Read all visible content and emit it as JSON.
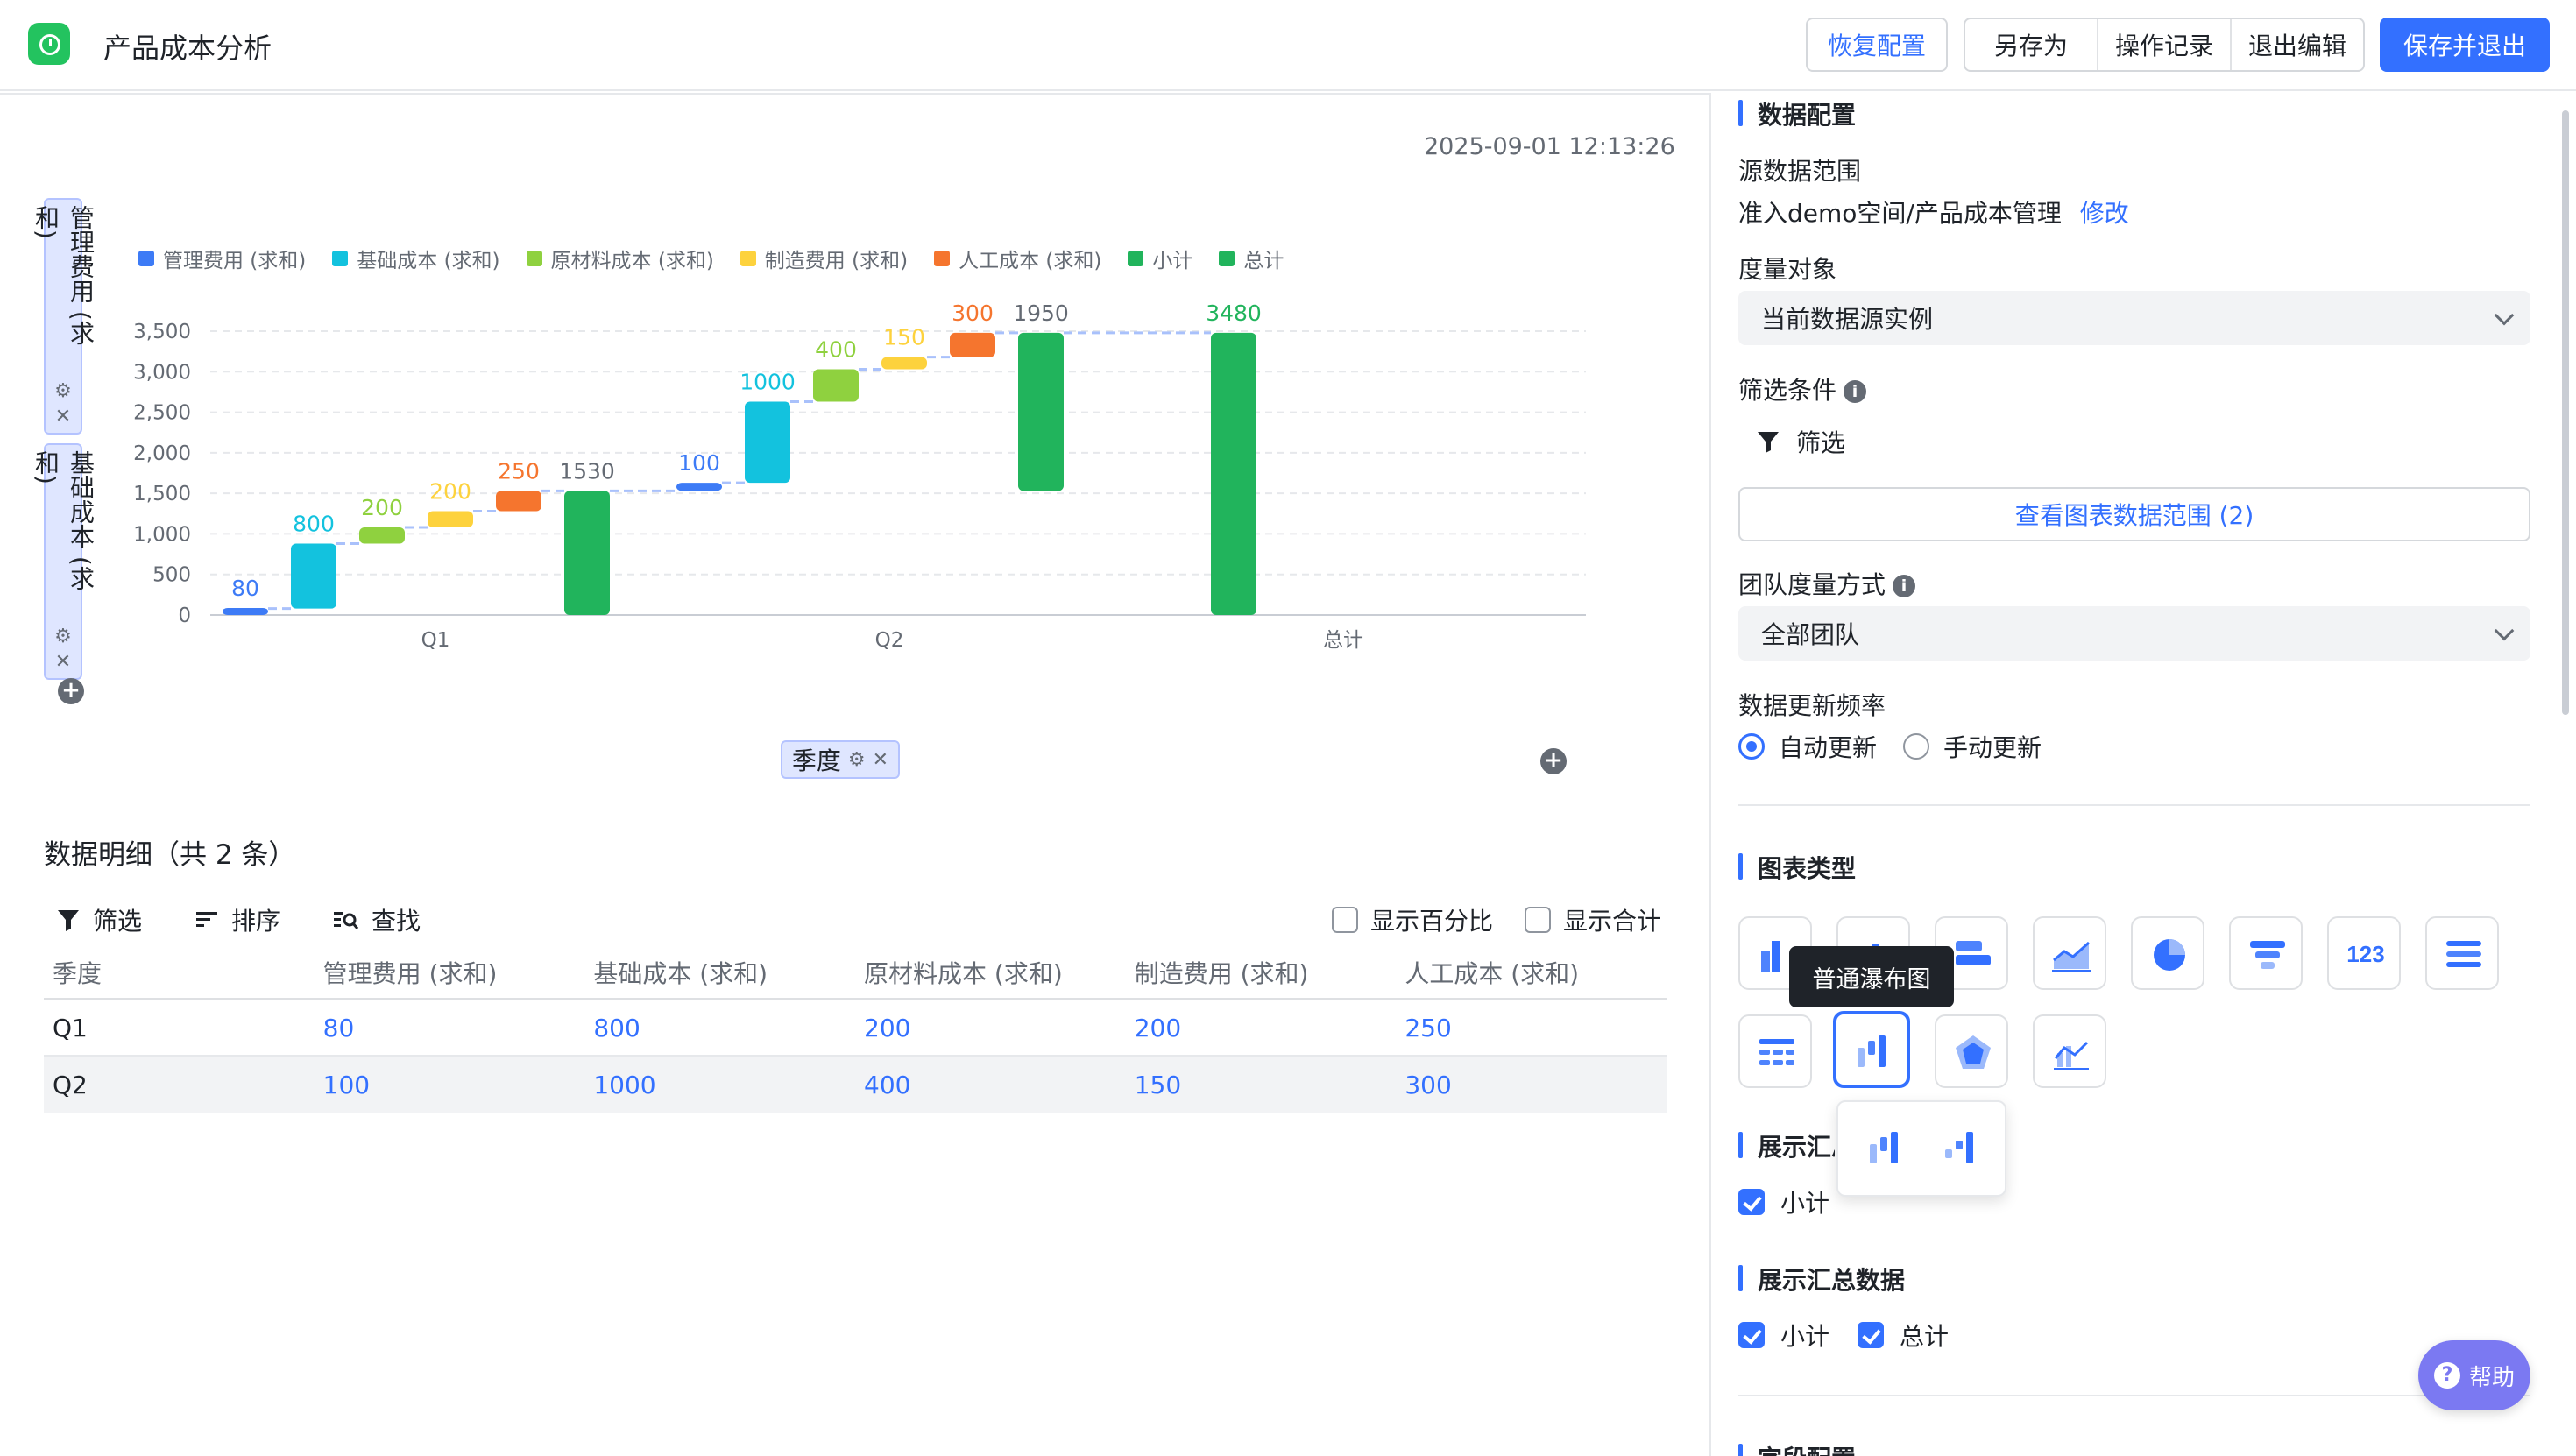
{
  "header": {
    "title": "产品成本分析",
    "restore_label": "恢复配置",
    "save_as_label": "另存为",
    "history_label": "操作记录",
    "exit_edit_label": "退出编辑",
    "save_exit_label": "保存并退出"
  },
  "chart_area": {
    "timestamp": "2025-09-01 12:13:26",
    "y_fields": [
      "管理费用 (求和)",
      "基础成本 (求和)"
    ],
    "x_field": "季度"
  },
  "chart_data": {
    "type": "waterfall",
    "legend": [
      {
        "name": "管理费用 (求和)",
        "color": "#3d7bf6"
      },
      {
        "name": "基础成本 (求和)",
        "color": "#13c2de"
      },
      {
        "name": "原材料成本 (求和)",
        "color": "#8fd13f"
      },
      {
        "name": "制造费用 (求和)",
        "color": "#fdd23d"
      },
      {
        "name": "人工成本 (求和)",
        "color": "#f5752e"
      },
      {
        "name": "小计",
        "color": "#21b45c"
      },
      {
        "name": "总计",
        "color": "#21b45c"
      }
    ],
    "categories": [
      "Q1",
      "Q2",
      "总计"
    ],
    "y_ticks": [
      "3,500",
      "3,000",
      "2,500",
      "2,000",
      "1,500",
      "1,000",
      "500",
      "0"
    ],
    "ylim": [
      0,
      3500
    ],
    "bars": [
      {
        "group": "Q1",
        "series": "管理费用 (求和)",
        "start": 0,
        "end": 80,
        "label": "80"
      },
      {
        "group": "Q1",
        "series": "基础成本 (求和)",
        "start": 80,
        "end": 880,
        "label": "800"
      },
      {
        "group": "Q1",
        "series": "原材料成本 (求和)",
        "start": 880,
        "end": 1080,
        "label": "200"
      },
      {
        "group": "Q1",
        "series": "制造费用 (求和)",
        "start": 1080,
        "end": 1280,
        "label": "200"
      },
      {
        "group": "Q1",
        "series": "人工成本 (求和)",
        "start": 1280,
        "end": 1530,
        "label": "250"
      },
      {
        "group": "Q1",
        "series": "小计",
        "start": 0,
        "end": 1530,
        "label": "1530"
      },
      {
        "group": "Q2",
        "series": "管理费用 (求和)",
        "start": 1530,
        "end": 1630,
        "label": "100"
      },
      {
        "group": "Q2",
        "series": "基础成本 (求和)",
        "start": 1630,
        "end": 2630,
        "label": "1000"
      },
      {
        "group": "Q2",
        "series": "原材料成本 (求和)",
        "start": 2630,
        "end": 3030,
        "label": "400"
      },
      {
        "group": "Q2",
        "series": "制造费用 (求和)",
        "start": 3030,
        "end": 3180,
        "label": "150"
      },
      {
        "group": "Q2",
        "series": "人工成本 (求和)",
        "start": 3180,
        "end": 3480,
        "label": "300"
      },
      {
        "group": "Q2",
        "series": "小计",
        "start": 1530,
        "end": 3480,
        "label": "1950"
      },
      {
        "group": "总计",
        "series": "总计",
        "start": 0,
        "end": 3480,
        "label": "3480"
      }
    ]
  },
  "detail": {
    "title": "数据明细（共 2 条）",
    "filter_label": "筛选",
    "sort_label": "排序",
    "find_label": "查找",
    "show_percent_label": "显示百分比",
    "show_total_label": "显示合计",
    "columns": [
      "季度",
      "管理费用 (求和)",
      "基础成本 (求和)",
      "原材料成本 (求和)",
      "制造费用 (求和)",
      "人工成本 (求和)"
    ],
    "rows": [
      [
        "Q1",
        "80",
        "800",
        "200",
        "200",
        "250"
      ],
      [
        "Q2",
        "100",
        "1000",
        "400",
        "150",
        "300"
      ]
    ]
  },
  "panel": {
    "data_config_title": "数据配置",
    "source_label": "源数据范围",
    "source_value": "准入demo空间/产品成本管理",
    "source_edit": "修改",
    "measure_label": "度量对象",
    "measure_value": "当前数据源实例",
    "filter_cond_label": "筛选条件",
    "filter_button": "筛选",
    "view_range_button": "查看图表数据范围 (2)",
    "team_measure_label": "团队度量方式",
    "team_measure_value": "全部团队",
    "update_freq_label": "数据更新频率",
    "auto_update": "自动更新",
    "manual_update": "手动更新",
    "chart_type_title": "图表类型",
    "chart_type_tooltip": "普通瀑布图",
    "show_summary_title": "展示汇总数据",
    "subtotal_label": "小计",
    "total_label": "总计",
    "field_config_title": "字段配置",
    "help_label": "帮助",
    "accent": "#3370ff"
  }
}
